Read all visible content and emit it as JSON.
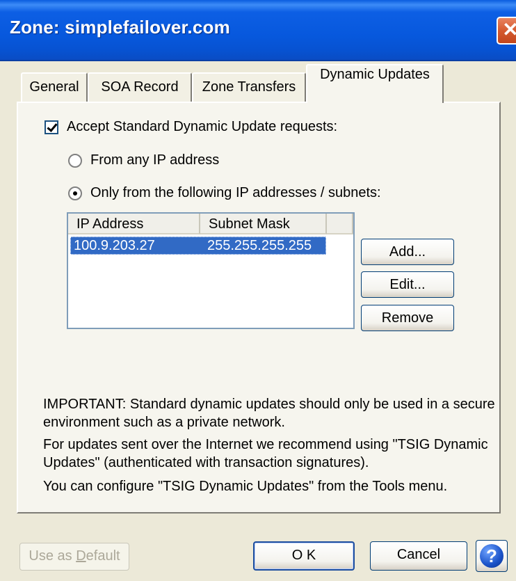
{
  "window": {
    "title": "Zone: simplefailover.com",
    "close_glyph": "✕"
  },
  "tabs": [
    {
      "label": "General"
    },
    {
      "label": "SOA Record"
    },
    {
      "label": "Zone Transfers"
    },
    {
      "label": "Dynamic Updates",
      "active": true
    }
  ],
  "dynamic_updates": {
    "accept_checkbox": {
      "label": "Accept Standard Dynamic Update requests:",
      "checked": true
    },
    "radio_any": {
      "label": "From any IP address",
      "checked": false
    },
    "radio_only": {
      "label": "Only from the following IP addresses / subnets:",
      "checked": true
    },
    "table": {
      "columns": [
        "IP Address",
        "Subnet Mask"
      ],
      "rows": [
        {
          "ip": "100.9.203.27",
          "mask": "255.255.255.255",
          "selected": true
        }
      ]
    },
    "buttons": {
      "add": "Add...",
      "edit": "Edit...",
      "remove": "Remove"
    },
    "notes": [
      "IMPORTANT: Standard dynamic updates should only be used in a secure environment such as a private network.",
      "For updates sent over the Internet we recommend using \"TSIG Dynamic Updates\" (authenticated with transaction signatures).",
      "You can configure \"TSIG Dynamic Updates\" from the Tools menu."
    ]
  },
  "footer": {
    "use_default_prefix": "Use as ",
    "use_default_key": "D",
    "use_default_suffix": "efault",
    "ok": "O K",
    "cancel": "Cancel",
    "help_glyph": "?"
  },
  "colors": {
    "titlebar": "#0758dd",
    "selection": "#316ac5",
    "dialog_bg": "#ece9d8"
  }
}
